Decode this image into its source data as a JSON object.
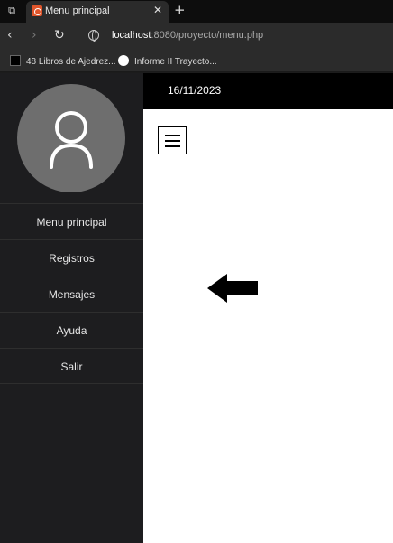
{
  "browser": {
    "tab_title": "Menu principal",
    "tab_close": "✕",
    "new_tab": "+",
    "url_host": "localhost",
    "url_rest": ":8080/proyecto/menu.php",
    "bookmarks": [
      {
        "label": "48 Libros de Ajedrez..."
      },
      {
        "label": "Informe II Trayecto..."
      }
    ]
  },
  "header": {
    "date": "16/11/2023"
  },
  "sidebar": {
    "items": [
      {
        "label": "Menu principal"
      },
      {
        "label": "Registros"
      },
      {
        "label": "Mensajes"
      },
      {
        "label": "Ayuda"
      },
      {
        "label": "Salir"
      }
    ]
  },
  "colors": {
    "sidebar_bg": "#1d1d1f",
    "header_bg": "#000000",
    "avatar_bg": "#6e6e6e"
  }
}
